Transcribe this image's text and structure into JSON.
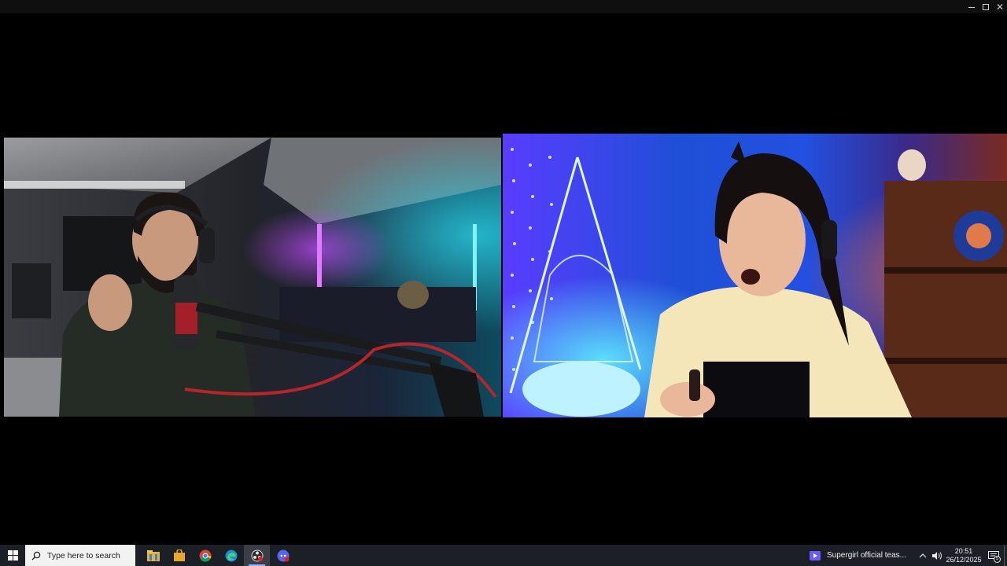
{
  "window": {
    "controls": [
      "minimize-icon",
      "maximize-icon",
      "close-icon"
    ],
    "close_glyph": "✕"
  },
  "videos": [
    {
      "id": "participant-left",
      "description_icon": "video-feed"
    },
    {
      "id": "participant-right",
      "description_icon": "video-feed"
    }
  ],
  "taskbar": {
    "search_placeholder": "Type here to search",
    "apps": [
      {
        "name": "file-explorer-icon"
      },
      {
        "name": "store-icon"
      },
      {
        "name": "chrome-icon"
      },
      {
        "name": "edge-icon"
      },
      {
        "name": "obs-icon",
        "active": true
      },
      {
        "name": "discord-icon"
      }
    ],
    "media_title": "Supergirl official teas...",
    "clock_time": "20:51",
    "clock_date": "26/12/2025",
    "notification_count": "5",
    "colors": {
      "background": "#1c1f26",
      "accent": "#8fb4ff"
    }
  }
}
